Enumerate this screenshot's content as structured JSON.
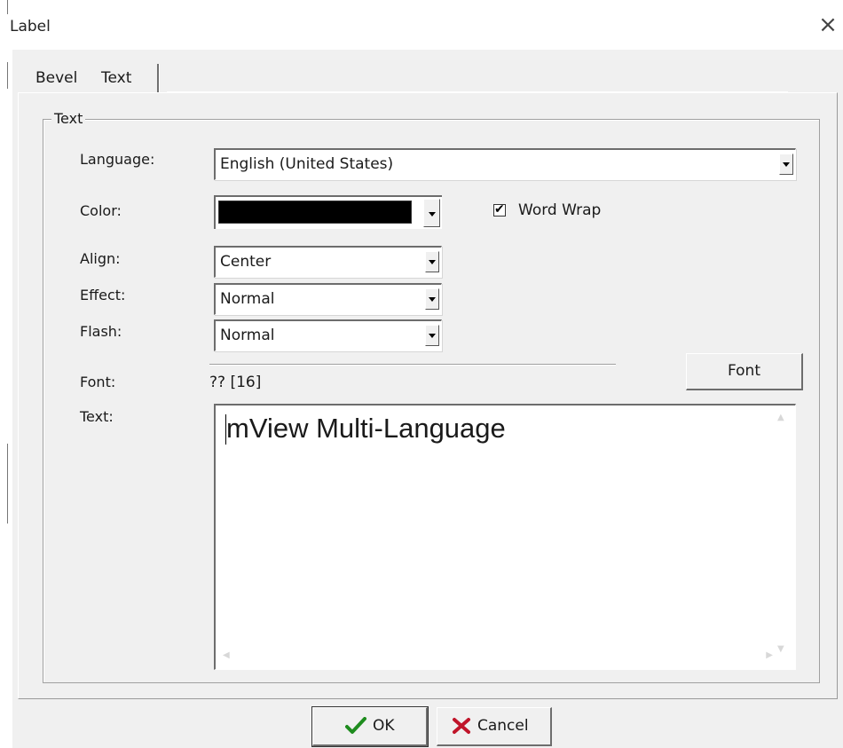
{
  "window": {
    "title": "Label",
    "close_glyph": "×"
  },
  "tabs": [
    {
      "label": "Bevel",
      "active": false
    },
    {
      "label": "Text",
      "active": true
    }
  ],
  "group": {
    "title": "Text"
  },
  "fields": {
    "language": {
      "label": "Language:",
      "value": "English (United States)"
    },
    "color": {
      "label": "Color:",
      "value": "#000000"
    },
    "word_wrap": {
      "label": "Word Wrap",
      "checked": true,
      "check_glyph": "✔"
    },
    "align": {
      "label": "Align:",
      "value": "Center"
    },
    "effect": {
      "label": "Effect:",
      "value": "Normal"
    },
    "flash": {
      "label": "Flash:",
      "value": "Normal"
    },
    "font": {
      "label": "Font:",
      "value": "?? [16]",
      "button_label": "Font"
    },
    "text": {
      "label": "Text:",
      "value": "mView Multi-Language"
    }
  },
  "buttons": {
    "ok": {
      "label": "OK",
      "icon": "check-icon",
      "icon_color": "#1e8c1e"
    },
    "cancel": {
      "label": "Cancel",
      "icon": "x-mark-icon",
      "icon_color": "#c0152a"
    }
  }
}
